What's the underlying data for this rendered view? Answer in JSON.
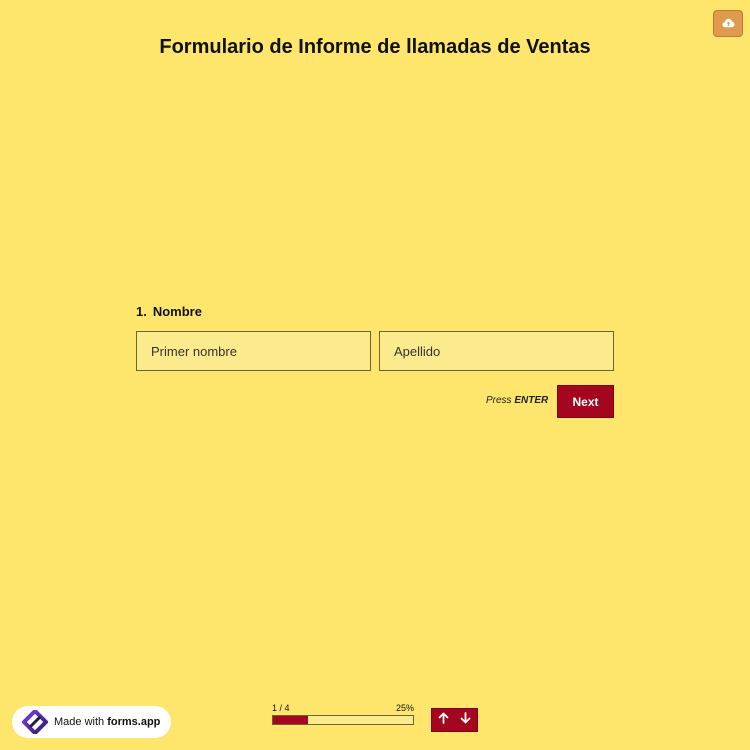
{
  "form": {
    "title": "Formulario de Informe de llamadas de Ventas"
  },
  "question": {
    "number": "1.",
    "label": "Nombre",
    "first_name_placeholder": "Primer nombre",
    "last_name_placeholder": "Apellido"
  },
  "actions": {
    "press_hint_prefix": "Press",
    "press_hint_key": "ENTER",
    "next_label": "Next",
    "save_icon": "cloud-upload-icon"
  },
  "progress": {
    "current_of_total": "1 / 4",
    "percent_label": "25%",
    "fraction": 0.25
  },
  "navigation": {
    "up_icon": "arrow-up-icon",
    "down_icon": "arrow-down-icon"
  },
  "badge": {
    "prefix": "Made with",
    "brand": "forms.app"
  },
  "colors": {
    "background": "#fde66b",
    "accent": "#a3061e",
    "input_background": "#fbeb8c",
    "save_button": "#e09a4e"
  }
}
